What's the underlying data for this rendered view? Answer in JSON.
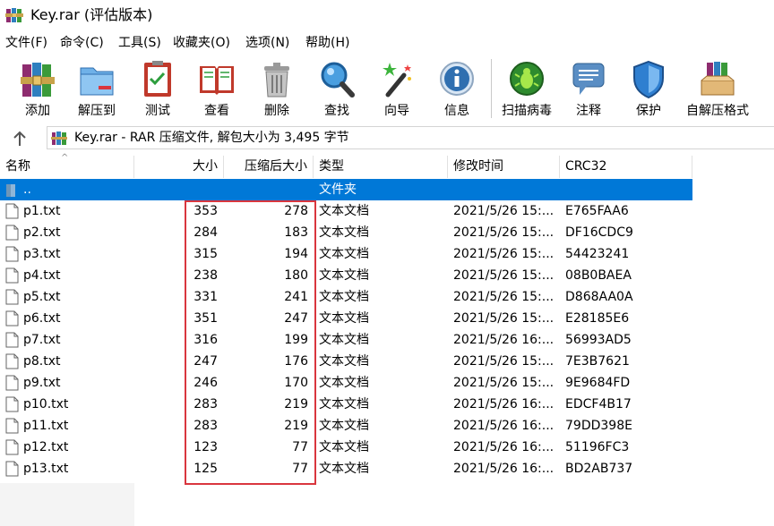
{
  "window": {
    "title": "Key.rar (评估版本)"
  },
  "menu": [
    "文件(F)",
    "命令(C)",
    "工具(S)",
    "收藏夹(O)",
    "选项(N)",
    "帮助(H)"
  ],
  "toolbar": {
    "buttons": [
      {
        "label": "添加",
        "icon": "books-icon"
      },
      {
        "label": "解压到",
        "icon": "folder-icon"
      },
      {
        "label": "测试",
        "icon": "clipboard-check-icon"
      },
      {
        "label": "查看",
        "icon": "open-book-icon"
      },
      {
        "label": "删除",
        "icon": "trash-icon"
      },
      {
        "label": "查找",
        "icon": "magnifier-icon"
      },
      {
        "label": "向导",
        "icon": "magic-wand-icon"
      },
      {
        "label": "信息",
        "icon": "info-icon"
      },
      {
        "label": "扫描病毒",
        "icon": "bug-icon"
      },
      {
        "label": "注释",
        "icon": "speech-bubble-icon"
      },
      {
        "label": "保护",
        "icon": "shield-icon"
      },
      {
        "label": "自解压格式",
        "icon": "box-books-icon"
      }
    ]
  },
  "address": {
    "text": "Key.rar - RAR 压缩文件, 解包大小为 3,495 字节"
  },
  "columns": {
    "name": "名称",
    "size": "大小",
    "packed": "压缩后大小",
    "type": "类型",
    "modified": "修改时间",
    "crc": "CRC32"
  },
  "parent_row": {
    "name": "..",
    "type": "文件夹"
  },
  "files": [
    {
      "name": "p1.txt",
      "size": "353",
      "packed": "278",
      "type": "文本文档",
      "modified": "2021/5/26 15:...",
      "crc": "E765FAA6"
    },
    {
      "name": "p2.txt",
      "size": "284",
      "packed": "183",
      "type": "文本文档",
      "modified": "2021/5/26 15:...",
      "crc": "DF16CDC9"
    },
    {
      "name": "p3.txt",
      "size": "315",
      "packed": "194",
      "type": "文本文档",
      "modified": "2021/5/26 15:...",
      "crc": "54423241"
    },
    {
      "name": "p4.txt",
      "size": "238",
      "packed": "180",
      "type": "文本文档",
      "modified": "2021/5/26 15:...",
      "crc": "08B0BAEA"
    },
    {
      "name": "p5.txt",
      "size": "331",
      "packed": "241",
      "type": "文本文档",
      "modified": "2021/5/26 15:...",
      "crc": "D868AA0A"
    },
    {
      "name": "p6.txt",
      "size": "351",
      "packed": "247",
      "type": "文本文档",
      "modified": "2021/5/26 15:...",
      "crc": "E28185E6"
    },
    {
      "name": "p7.txt",
      "size": "316",
      "packed": "199",
      "type": "文本文档",
      "modified": "2021/5/26 16:...",
      "crc": "56993AD5"
    },
    {
      "name": "p8.txt",
      "size": "247",
      "packed": "176",
      "type": "文本文档",
      "modified": "2021/5/26 15:...",
      "crc": "7E3B7621"
    },
    {
      "name": "p9.txt",
      "size": "246",
      "packed": "170",
      "type": "文本文档",
      "modified": "2021/5/26 15:...",
      "crc": "9E9684FD"
    },
    {
      "name": "p10.txt",
      "size": "283",
      "packed": "219",
      "type": "文本文档",
      "modified": "2021/5/26 16:...",
      "crc": "EDCF4B17"
    },
    {
      "name": "p11.txt",
      "size": "283",
      "packed": "219",
      "type": "文本文档",
      "modified": "2021/5/26 16:...",
      "crc": "79DD398E"
    },
    {
      "name": "p12.txt",
      "size": "123",
      "packed": "77",
      "type": "文本文档",
      "modified": "2021/5/26 16:...",
      "crc": "51196FC3"
    },
    {
      "name": "p13.txt",
      "size": "125",
      "packed": "77",
      "type": "文本文档",
      "modified": "2021/5/26 16:...",
      "crc": "BD2AB737"
    }
  ],
  "colors": {
    "selection": "#0078d7",
    "highlight_box": "#d9363e"
  }
}
